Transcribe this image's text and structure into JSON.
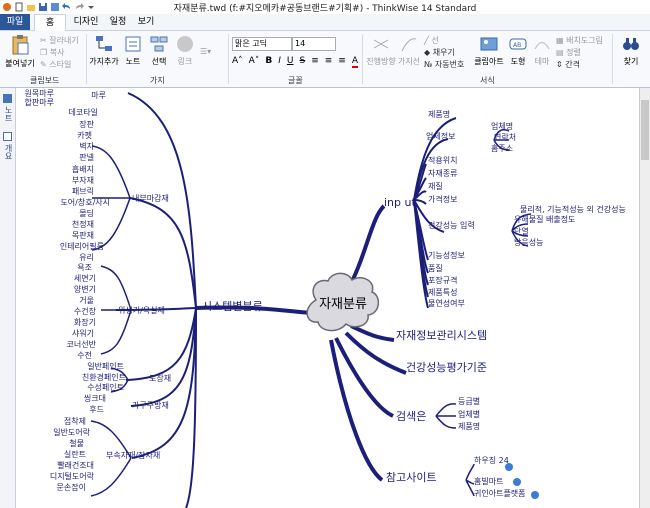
{
  "window": {
    "title": "자재분류.twd (f:#지오메카#공동브랜드#기획#) - ThinkWise 14 Standard"
  },
  "menu": {
    "tabs": [
      "파일",
      "홈",
      "디자인",
      "일정",
      "보기"
    ]
  },
  "ribbon": {
    "clipboard": {
      "paste": "붙여넣기",
      "cut": "잘라내기",
      "copy": "복사",
      "style": "스타일",
      "label": "클립보드"
    },
    "branch": {
      "add": "가지추가",
      "note": "노트",
      "select": "선택",
      "link": "링크",
      "label": "가지"
    },
    "font": {
      "name": "맑은 고딕",
      "size": "14",
      "label": "글꼴"
    },
    "format": {
      "direction": "진행방향",
      "branch": "가지선",
      "line": "선",
      "fill": "채우기",
      "numbering": "자동번호",
      "clipart": "클립아트",
      "shape": "도형",
      "theme": "테마",
      "spacing": "간격",
      "bg_image": "배치도그림",
      "align": "정렬",
      "label": "서식"
    },
    "find": {
      "label": "찾기"
    }
  },
  "side": {
    "tab1": "노트",
    "tab2": "개요"
  },
  "mindmap": {
    "root": "자재분류",
    "input": {
      "label": "inp ut",
      "items": [
        "제품명",
        "업체정보",
        "업체명",
        "연락처",
        "홈주소",
        "적용위치",
        "자재종류",
        "재질",
        "가격정보",
        "건강성능 입력",
        "물리적, 기능적성능 외 건강성능",
        "유해물질 배출정도",
        "단열",
        "방음성능",
        "기능성정보",
        "품질",
        "포장규격",
        "제품특성",
        "물연성여부"
      ]
    },
    "right": {
      "mgmt": "자재정보관리시스템",
      "health": "건강성능평가기준",
      "search": "검색은",
      "search_items": [
        "등급별",
        "업체별",
        "제품명"
      ],
      "ref": "참고사이트",
      "ref_items": [
        "하우징 24",
        "홈빌마트",
        "귀인아트플랫폼"
      ]
    },
    "system": {
      "label": "시스템별분류",
      "top": [
        "원목마루",
        "합판마루",
        "마루",
        "데코타일",
        "장판",
        "카펫"
      ],
      "interior": {
        "label": "내부마감재",
        "items": [
          "벽지",
          "판넬",
          "흡배지",
          "부자재",
          "패브릭",
          "도어/창호/사시",
          "몰딩",
          "천정재",
          "목판재",
          "인테리어필름",
          "유리"
        ]
      },
      "bath": {
        "label": "위생기/욕실재",
        "items": [
          "욕조",
          "세면기",
          "양변기",
          "거울",
          "수건장",
          "화장기",
          "샤워기",
          "코너선반",
          "수전"
        ]
      },
      "paint": {
        "label": "도장재",
        "items": [
          "일반페인트",
          "친환경페인트",
          "수성페인트"
        ]
      },
      "furniture": {
        "label": "가구주방재",
        "items": [
          "씽크대",
          "후드"
        ]
      },
      "sub": {
        "label": "부속자재/잡자재",
        "items": [
          "접착제",
          "일반도어락",
          "철물",
          "실란트",
          "빨래건조대",
          "디지털도어락",
          "문손잡이"
        ]
      }
    }
  }
}
